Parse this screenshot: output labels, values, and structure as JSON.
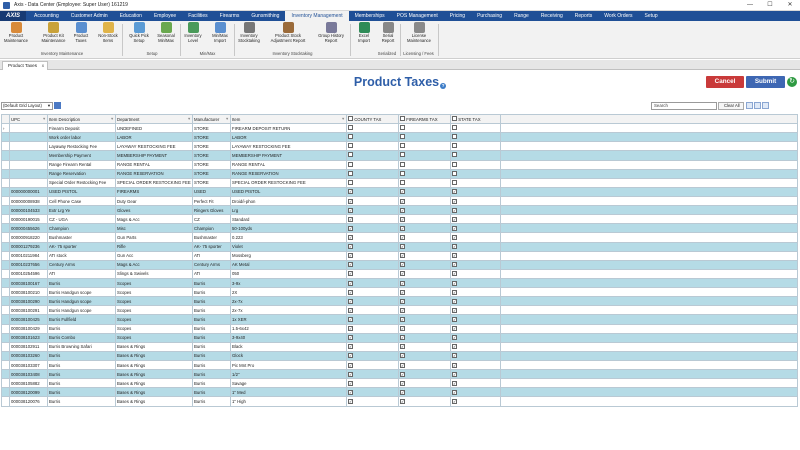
{
  "window": {
    "title": "Axis - Data Center (Employee: Super User) 161219",
    "minimize": "—",
    "maximize": "☐",
    "close": "✕"
  },
  "menu": {
    "logo": "AXIS",
    "items": [
      "Accounting",
      "Customer Admin",
      "Education",
      "Employee",
      "Facilities",
      "Firearms",
      "Gunsmithing",
      "Inventory Management",
      "Memberships",
      "POS Management",
      "Pricing",
      "Purchasing",
      "Range",
      "Receiving",
      "Reports",
      "Work Orders",
      "Setup"
    ],
    "active": "Inventory Management"
  },
  "ribbon": {
    "buttons": [
      {
        "label": "Product Maintenance",
        "icon": "product-box-icon",
        "color": "#d88a3a"
      },
      {
        "label": "Product Kit Maintenance",
        "icon": "kit-icon",
        "color": "#c9a23a"
      },
      {
        "label": "Product Taxes",
        "icon": "taxes-icon",
        "color": "#5a8fd0"
      },
      {
        "label": "Non-Stock Items",
        "icon": "non-stock-icon",
        "color": "#e0b44a"
      },
      {
        "label": "Quick Pick Setup",
        "icon": "quick-pick-icon",
        "color": "#5b9bd5"
      },
      {
        "label": "Seasonal Min/Max",
        "icon": "seasonal-icon",
        "color": "#6aa84f"
      },
      {
        "label": "Inventory Level",
        "icon": "inventory-level-icon",
        "color": "#4a9a5a"
      },
      {
        "label": "Min/Max Import",
        "icon": "minmax-import-icon",
        "color": "#5a8fd0"
      },
      {
        "label": "Inventory Stocktaking",
        "icon": "stocktaking-icon",
        "color": "#777777"
      },
      {
        "label": "Product Stock Adjustment Report",
        "icon": "stock-report-icon",
        "color": "#9b6b3a"
      },
      {
        "label": "Group History Report",
        "icon": "group-history-icon",
        "color": "#7a7a9a"
      },
      {
        "label": "Excel Import",
        "icon": "excel-icon",
        "color": "#2e8b57"
      },
      {
        "label": "Serial Report",
        "icon": "serial-report-icon",
        "color": "#888888"
      },
      {
        "label": "License Maintenance",
        "icon": "license-icon",
        "color": "#8a8a8a"
      }
    ],
    "groups": [
      "Inventory Maintenance",
      "Setup",
      "Min/Max",
      "Inventory Stocktaking",
      "Serialized",
      "Licensing / Fees"
    ]
  },
  "tab": {
    "label": "Product Taxes",
    "close": "x"
  },
  "page": {
    "title": "Product Taxes",
    "help": "?"
  },
  "actions": {
    "cancel": "Cancel",
    "submit": "Submit"
  },
  "toolbar": {
    "layout": "(Default Grid Layout)",
    "search_value": "Search",
    "clear_all": "Clear All"
  },
  "columns": [
    "UPC",
    "Item Description",
    "Department",
    "Manufacturer",
    "Item",
    "COUNTY TAX",
    "FIREARMS TAX",
    "STATE TAX"
  ],
  "rows": [
    {
      "upc": "",
      "desc": "Firearm Deposit",
      "dept": "UNDEFINED",
      "mfr": "STORE",
      "item": "FIREARM DEPOSIT RETURN",
      "county": false,
      "firearms": false,
      "state": false
    },
    {
      "upc": "",
      "desc": "Work order labor",
      "dept": "LABOR",
      "mfr": "STORE",
      "item": "LABOR",
      "county": false,
      "firearms": false,
      "state": false
    },
    {
      "upc": "",
      "desc": "Layaway Restocking Fee",
      "dept": "LAYAWAY RESTOCKING FEE",
      "mfr": "STORE",
      "item": "LAYAWAY RESTOCKING FEE",
      "county": false,
      "firearms": false,
      "state": false
    },
    {
      "upc": "",
      "desc": "Membership Payment",
      "dept": "MEMBERSHIP PAYMENT",
      "mfr": "STORE",
      "item": "MEMBERSHIP PAYMENT",
      "county": false,
      "firearms": false,
      "state": false
    },
    {
      "upc": "",
      "desc": "Range Firearm Rental",
      "dept": "RANGE RENTAL",
      "mfr": "STORE",
      "item": "RANGE RENTAL",
      "county": false,
      "firearms": false,
      "state": false
    },
    {
      "upc": "",
      "desc": "Range Reservation",
      "dept": "RANGE RESERVATION",
      "mfr": "STORE",
      "item": "RANGE RESERVATION",
      "county": false,
      "firearms": false,
      "state": false
    },
    {
      "upc": "",
      "desc": "Special Order Restocking Fee",
      "dept": "SPECIAL ORDER RESTOCKING FEE",
      "mfr": "STORE",
      "item": "SPECIAL ORDER RESTOCKING FEE",
      "county": false,
      "firearms": false,
      "state": false
    },
    {
      "upc": "000000000001",
      "desc": "USED PISTOL",
      "dept": "FIREARMS",
      "mfr": "USED",
      "item": "USED PISTOL",
      "county": true,
      "firearms": true,
      "state": true
    },
    {
      "upc": "000000008938",
      "desc": "Cell Phone Case",
      "dept": "Duty Gear",
      "mfr": "Perfect Fit",
      "item": "Droid/i-phon",
      "county": true,
      "firearms": true,
      "state": true
    },
    {
      "upc": "000000104533",
      "desc": "Extr Lrg Ye",
      "dept": "Gloves",
      "mfr": "Ringers Gloves",
      "item": "Lrg",
      "county": true,
      "firearms": true,
      "state": true
    },
    {
      "upc": "000000190015",
      "desc": "CZ - UGA",
      "dept": "Mags & Acc",
      "mfr": "CZ",
      "item": "Standard",
      "county": true,
      "firearms": true,
      "state": true
    },
    {
      "upc": "000000455626",
      "desc": "Champion",
      "dept": "Misc",
      "mfr": "Champion",
      "item": "50-100yds",
      "county": true,
      "firearms": true,
      "state": true
    },
    {
      "upc": "000000918220",
      "desc": "Bushmaster",
      "dept": "Gun Parts",
      "mfr": "Bushmaster",
      "item": "0.223",
      "county": true,
      "firearms": true,
      "state": true
    },
    {
      "upc": "000001279236",
      "desc": "AK- 75 sporter",
      "dept": "Rifle",
      "mfr": "AK- 75 sporter",
      "item": "Violet",
      "county": true,
      "firearms": true,
      "state": true
    },
    {
      "upc": "000010211984",
      "desc": "ATI stock",
      "dept": "Gun Acc",
      "mfr": "ATI",
      "item": "Mossberg",
      "county": true,
      "firearms": true,
      "state": true
    },
    {
      "upc": "000010237656",
      "desc": "Century Arms",
      "dept": "Mags & Acc",
      "mfr": "Century Arms",
      "item": "AK Metal",
      "county": true,
      "firearms": true,
      "state": true
    },
    {
      "upc": "000010254596",
      "desc": "ATI",
      "dept": "Slings & Swivels",
      "mfr": "ATI",
      "item": "050",
      "county": true,
      "firearms": true,
      "state": true
    },
    {
      "upc": "000038100167",
      "desc": "Burris",
      "dept": "Scopes",
      "mfr": "Burris",
      "item": "3-9x",
      "county": true,
      "firearms": true,
      "state": true
    },
    {
      "upc": "000038100210",
      "desc": "Burris Handgun scope",
      "dept": "Scopes",
      "mfr": "Burris",
      "item": "2X",
      "county": true,
      "firearms": true,
      "state": true
    },
    {
      "upc": "000038100290",
      "desc": "Burris Handgun scope",
      "dept": "Scopes",
      "mfr": "Burris",
      "item": "2x-7x",
      "county": true,
      "firearms": true,
      "state": true
    },
    {
      "upc": "000038100291",
      "desc": "Burris Handgun scope",
      "dept": "Scopes",
      "mfr": "Burris",
      "item": "2x-7x",
      "county": true,
      "firearms": true,
      "state": true
    },
    {
      "upc": "000038100425",
      "desc": "Burris Fullfield",
      "dept": "Scopes",
      "mfr": "Burris",
      "item": "1x XER",
      "county": true,
      "firearms": true,
      "state": true
    },
    {
      "upc": "000038100429",
      "desc": "Burris",
      "dept": "Scopes",
      "mfr": "Burris",
      "item": "1.5-6x42",
      "county": true,
      "firearms": true,
      "state": true
    },
    {
      "upc": "000038101623",
      "desc": "Burris Combo",
      "dept": "Scopes",
      "mfr": "Burris",
      "item": "3-9x40",
      "county": true,
      "firearms": true,
      "state": true
    },
    {
      "upc": "000038102911",
      "desc": "Burris Browning Safari",
      "dept": "Bases & Rings",
      "mfr": "Burris",
      "item": "Black",
      "county": true,
      "firearms": true,
      "state": true
    },
    {
      "upc": "000038103260",
      "desc": "Burris",
      "dept": "Bases & Rings",
      "mfr": "Burris",
      "item": "Glock",
      "county": true,
      "firearms": true,
      "state": true
    },
    {
      "upc": "000038103307",
      "desc": "Burris",
      "dept": "Bases & Rings",
      "mfr": "Burris",
      "item": "Pic Mnt Pro",
      "county": true,
      "firearms": true,
      "state": true
    },
    {
      "upc": "000038103408",
      "desc": "Burris",
      "dept": "Bases & Rings",
      "mfr": "Burris",
      "item": "1/2\"",
      "county": true,
      "firearms": true,
      "state": true
    },
    {
      "upc": "000038105882",
      "desc": "Burris",
      "dept": "Bases & Rings",
      "mfr": "Burris",
      "item": "Savage",
      "county": true,
      "firearms": true,
      "state": true
    },
    {
      "upc": "000038120099",
      "desc": "Burris",
      "dept": "Bases & Rings",
      "mfr": "Burris",
      "item": "1\" Med",
      "county": true,
      "firearms": true,
      "state": true
    },
    {
      "upc": "000038120076",
      "desc": "Burris",
      "dept": "Bases & Rings",
      "mfr": "Burris",
      "item": "1\" High",
      "county": true,
      "firearms": true,
      "state": true
    }
  ]
}
